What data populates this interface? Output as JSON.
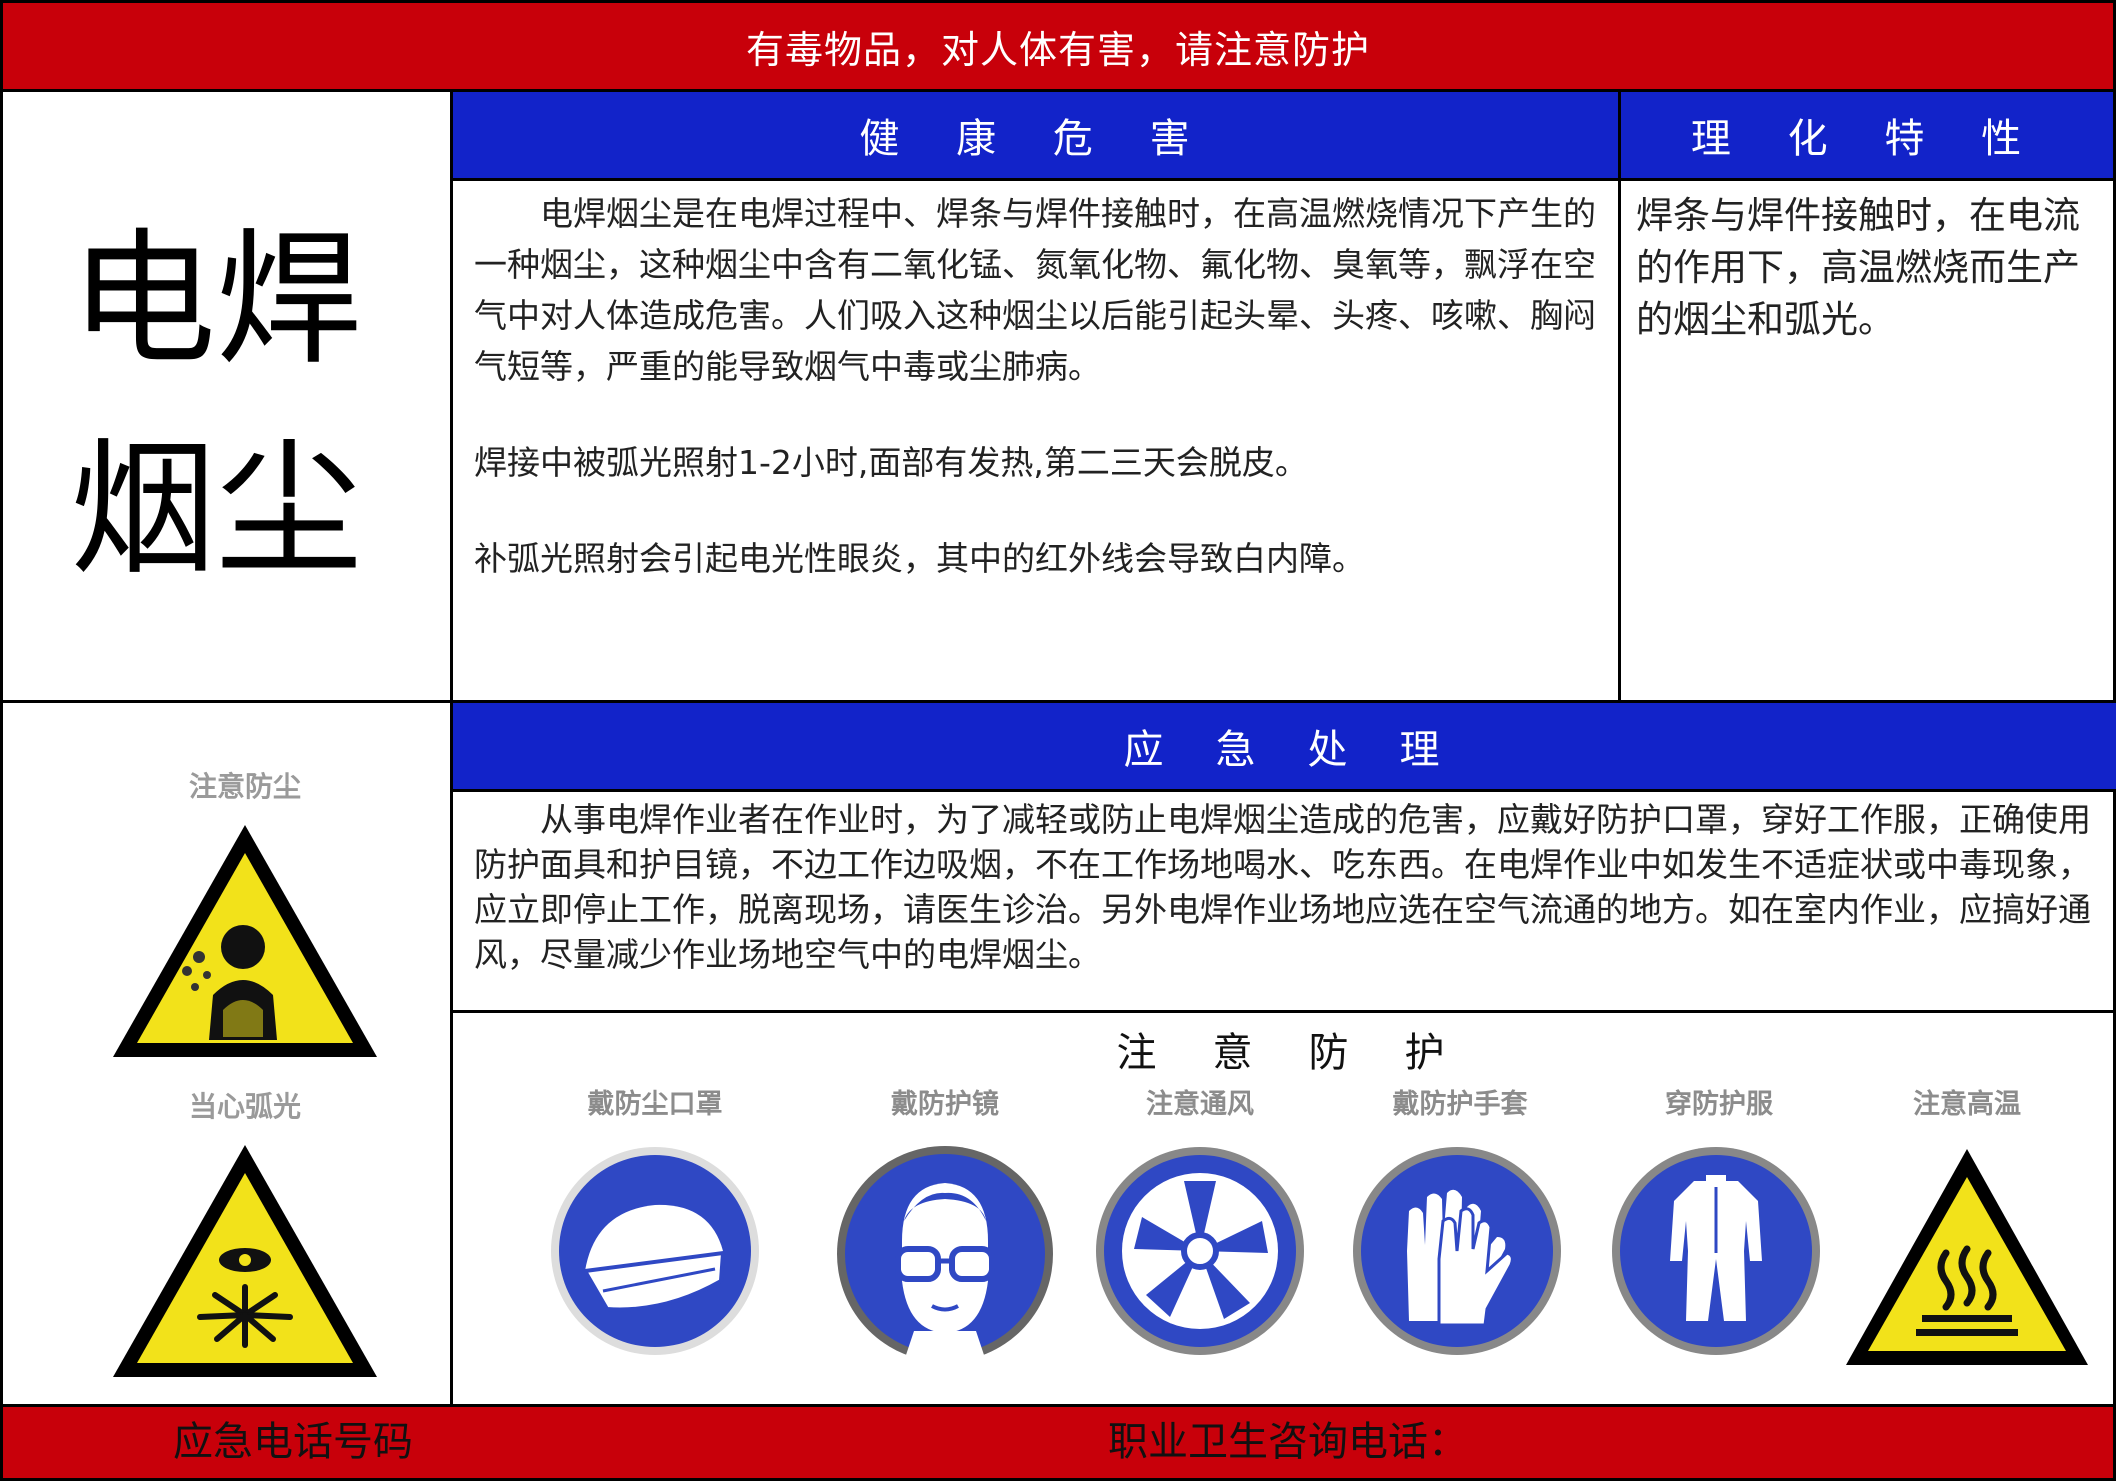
{
  "header": {
    "warning": "有毒物品，对人体有害，请注意防护"
  },
  "title": {
    "line1": "电焊",
    "line2": "烟尘"
  },
  "health": {
    "heading": "健 康 危 害",
    "para1": "电焊烟尘是在电焊过程中、焊条与焊件接触时，在高温燃烧情况下产生的一种烟尘，这种烟尘中含有二氧化锰、氮氧化物、氟化物、臭氧等，飘浮在空气中对人体造成危害。人们吸入这种烟尘以后能引起头晕、头疼、咳嗽、胸闷气短等，严重的能导致烟气中毒或尘肺病。",
    "para2": "焊接中被弧光照射1-2小时,面部有发热,第二三天会脱皮。",
    "para3": "补弧光照射会引起电光性眼炎，其中的红外线会导致白内障。"
  },
  "properties": {
    "heading": "理 化 特 性",
    "text": "焊条与焊件接触时，在电流的作用下，高温燃烧而生产的烟尘和弧光。"
  },
  "emergency": {
    "heading": "应　急　处　理",
    "text": "从事电焊作业者在作业时，为了减轻或防止电焊烟尘造成的危害，应戴好防护口罩，穿好工作服，正确使用防护面具和护目镜，不边工作边吸烟，不在工作场地喝水、吃东西。在电焊作业中如发生不适症状或中毒现象，应立即停止工作，脱离现场，请医生诊治。另外电焊作业场地应选在空气流通的地方。如在室内作业，应搞好通风，尽量减少作业场地空气中的电焊烟尘。"
  },
  "warning_signs": [
    {
      "label": "注意防尘",
      "icon": "dust-warning-icon"
    },
    {
      "label": "当心弧光",
      "icon": "arc-light-warning-icon"
    }
  ],
  "protection": {
    "heading": "注　意　防　护",
    "items": [
      {
        "label": "戴防尘口罩",
        "icon": "dust-mask-icon"
      },
      {
        "label": "戴防护镜",
        "icon": "goggles-icon"
      },
      {
        "label": "注意通风",
        "icon": "ventilation-icon"
      },
      {
        "label": "戴防护手套",
        "icon": "gloves-icon"
      },
      {
        "label": "穿防护服",
        "icon": "protective-suit-icon"
      },
      {
        "label": "注意高温",
        "icon": "high-temperature-warning-icon"
      }
    ]
  },
  "footer": {
    "emergency_phone_label": "应急电话号码",
    "consult_phone_label": "职业卫生咨询电话："
  },
  "colors": {
    "red": "#c8000a",
    "blue": "#1223c9",
    "sign_blue": "#2f48c4",
    "sign_yellow": "#f2e21a"
  }
}
